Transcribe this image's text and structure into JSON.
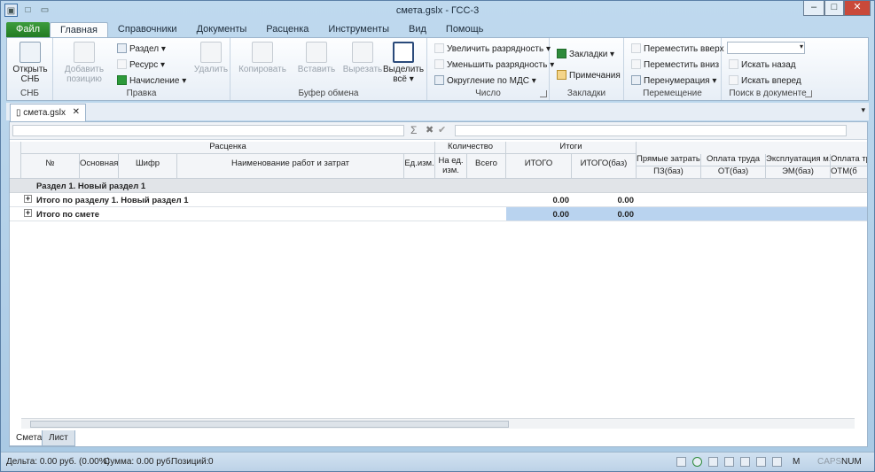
{
  "window": {
    "title": "смета.gslx - ГСС-3"
  },
  "ribbon_tabs": [
    "Файл",
    "Главная",
    "Справочники",
    "Документы",
    "Расценка",
    "Инструменты",
    "Вид",
    "Помощь"
  ],
  "ribbon": {
    "snb": {
      "open": "Открыть СНБ",
      "label": "СНБ"
    },
    "pravka": {
      "add": "Добавить позицию",
      "section": "Раздел",
      "resource": "Ресурс",
      "accrual": "Начисление",
      "delete": "Удалить",
      "label": "Правка"
    },
    "buffer": {
      "copy": "Копировать",
      "paste": "Вставить",
      "cut": "Вырезать",
      "select_all": "Выделить всё",
      "label": "Буфер обмена"
    },
    "number": {
      "inc": "Увеличить разрядность",
      "dec": "Уменьшить разрядность",
      "round": "Округление по МДС",
      "label": "Число"
    },
    "bookmarks": {
      "bookmarks": "Закладки",
      "notes": "Примечания",
      "label": "Закладки"
    },
    "move": {
      "up": "Переместить вверх",
      "down": "Переместить вниз",
      "renum": "Перенумерация",
      "label": "Перемещение"
    },
    "search": {
      "back": "Искать назад",
      "fwd": "Искать вперед",
      "label": "Поиск в документе"
    }
  },
  "doc_tab": "смета.gslx",
  "grid": {
    "groups": {
      "rasc": "Расценка",
      "qty": "Количество",
      "totals": "Итоги"
    },
    "cols": {
      "num": "№",
      "osn": "Основная",
      "shifr": "Шифр",
      "name": "Наименование работ и затрат",
      "unit": "Ед.изм.",
      "per_unit": "На ед. изм.",
      "total": "Всего",
      "itogo": "ИТОГО",
      "itogo_baz": "ИТОГО(баз)"
    },
    "extra": [
      {
        "t": "Прямые затраты",
        "b": "ПЗ(баз)"
      },
      {
        "t": "Оплата труда",
        "b": "ОТ(баз)"
      },
      {
        "t": "Эксплуатация м...",
        "b": "ЭМ(баз)"
      },
      {
        "t": "Оплата тр",
        "b": "ОТМ(б"
      }
    ],
    "section_row": "Раздел 1. Новый раздел 1",
    "sub_row": {
      "label": "Итого по разделу 1. Новый раздел 1",
      "itogo": "0.00",
      "baz": "0.00"
    },
    "total_row": {
      "label": "Итого по смете",
      "itogo": "0.00",
      "baz": "0.00"
    }
  },
  "sheet_tabs": [
    "Смета",
    "Лист"
  ],
  "status": {
    "delta": "Дельта: 0.00 руб. (0.00%)",
    "sum": "Сумма: 0.00 руб.",
    "positions": "Позиций:",
    "positions_val": "0",
    "m": "M",
    "caps": "CAPS",
    "num": "NUM"
  }
}
